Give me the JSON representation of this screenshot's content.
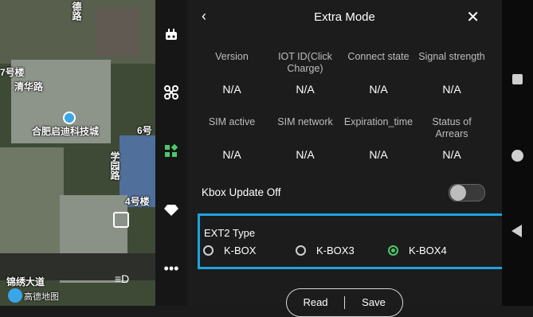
{
  "map": {
    "labels": [
      "德路",
      "7号楼",
      "清华路",
      "合肥启迪科技城",
      "6号",
      "学园路",
      "4号楼",
      "锦绣大道",
      "高德地图"
    ]
  },
  "header": {
    "title": "Extra Mode"
  },
  "table": {
    "headers1": [
      "Version",
      "IOT ID(Click Charge)",
      "Connect state",
      "Signal strength"
    ],
    "values1": [
      "N/A",
      "N/A",
      "N/A",
      "N/A"
    ],
    "headers2": [
      "SIM active",
      "SIM network",
      "Expiration_time",
      "Status of Arrears"
    ],
    "values2": [
      "N/A",
      "N/A",
      "N/A",
      "N/A"
    ]
  },
  "kbox": {
    "label": "Kbox Update Off",
    "enabled": false
  },
  "ext2": {
    "label": "EXT2 Type",
    "options": [
      "K-BOX",
      "K-BOX3",
      "K-BOX4"
    ],
    "selected": "K-BOX4"
  },
  "actions": {
    "read": "Read",
    "save": "Save"
  },
  "colors": {
    "highlight": "#1ea3e0",
    "radio_selected": "#4cc86b"
  }
}
